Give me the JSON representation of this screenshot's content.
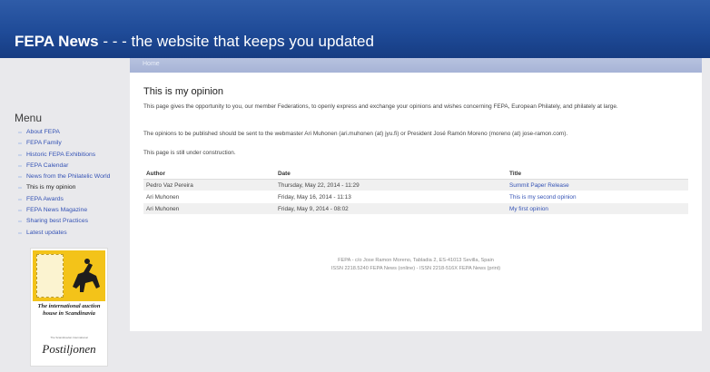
{
  "site": {
    "title_bold": "FEPA News",
    "title_rest": " - - - the website that keeps you updated",
    "breadcrumb": "Home"
  },
  "sidebar": {
    "title": "Menu",
    "items": [
      {
        "label": "About FEPA"
      },
      {
        "label": "FEPA Family"
      },
      {
        "label": "Historic FEPA Exhibitions"
      },
      {
        "label": "FEPA Calendar"
      },
      {
        "label": "News from the Philatelic World"
      },
      {
        "label": "This is my opinion",
        "current": true
      },
      {
        "label": "FEPA Awards"
      },
      {
        "label": "FEPA News Magazine"
      },
      {
        "label": "Sharing best Practices"
      },
      {
        "label": "Latest updates"
      }
    ],
    "ad": {
      "text": "The international auction house in Scandinavia",
      "small": "The Scandinavian International",
      "logo": "Postiljonen"
    }
  },
  "main": {
    "title": "This is my opinion",
    "paragraphs": [
      "This page gives the opportunity to you, our member Federations, to openly express and exchange your opinions and wishes concerning FEPA, European Philately, and philately at large.",
      "The opinions to be published should be sent to the webmaster Ari Muhonen (ari.muhonen (at) jyu.fi) or President José Ramón Moreno (moreno (at) jose-ramon.com).",
      "This page is still under construction."
    ],
    "table": {
      "headers": [
        "Author",
        "Date",
        "Title"
      ],
      "rows": [
        [
          "Pedro Vaz Pereira",
          "Thursday, May 22, 2014 - 11:29",
          "Summit Paper Release"
        ],
        [
          "Ari Muhonen",
          "Friday, May 16, 2014 - 11:13",
          "This is my second opinion"
        ],
        [
          "Ari Muhonen",
          "Friday, May 9, 2014 - 08:02",
          "My first opinion"
        ]
      ]
    },
    "footer": [
      "FEPA - c/o Jose Ramon Moreno, Tabladia 2, ES-41013 Sevilla, Spain",
      "ISSN 2218.5240 FEPA News (online) - ISSN 2218-516X FEPA News (print)"
    ]
  }
}
